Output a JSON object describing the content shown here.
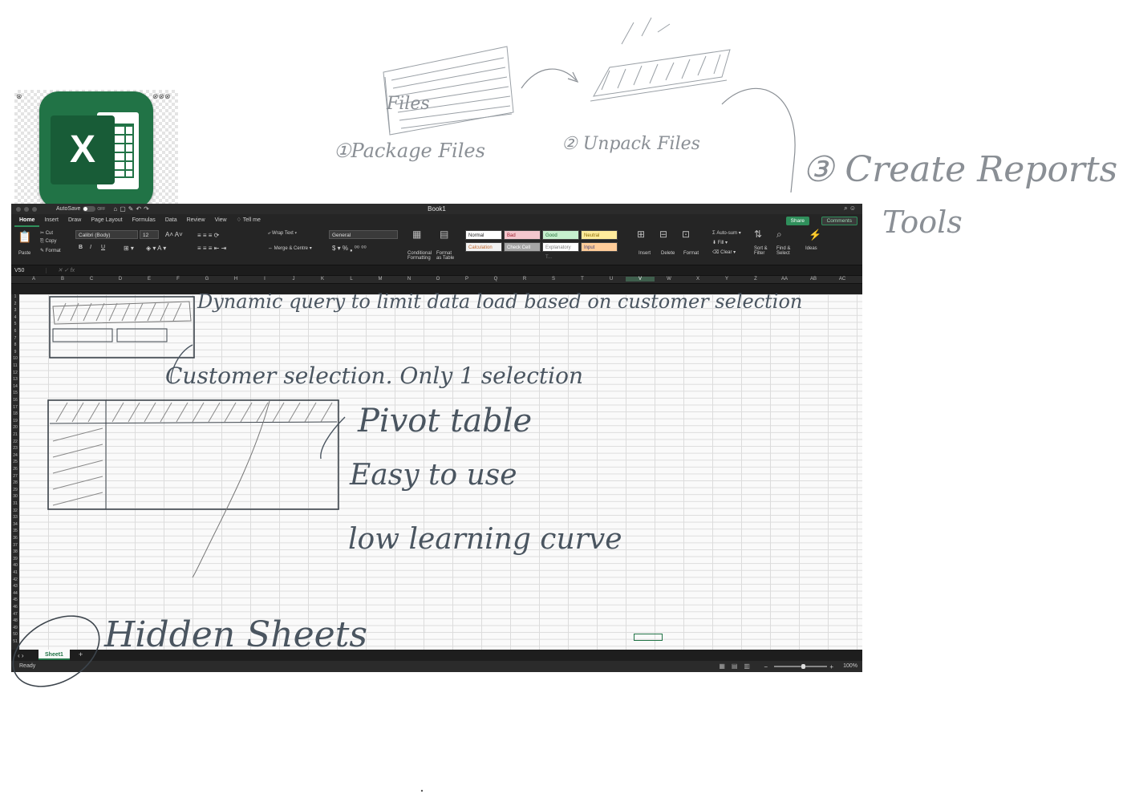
{
  "app_icon": {
    "letter": "X"
  },
  "window": {
    "title": "Book1",
    "autosave_label": "AutoSave",
    "autosave_state": "OFF"
  },
  "tabs": [
    "Home",
    "Insert",
    "Draw",
    "Page Layout",
    "Formulas",
    "Data",
    "Review",
    "View"
  ],
  "tell_me": "Tell me",
  "share_label": "Share",
  "comments_label": "Comments",
  "ribbon": {
    "paste": "Paste",
    "cut": "Cut",
    "copy": "Copy",
    "format": "Format",
    "font_name": "Calibri (Body)",
    "font_size": "12",
    "bold": "B",
    "italic": "I",
    "underline": "U",
    "wrap_text": "Wrap Text",
    "merge_centre": "Merge & Centre",
    "number_format": "General",
    "currency": "$",
    "percent": "%",
    "conditional_formatting": [
      "Conditional",
      "Formatting"
    ],
    "format_as_table": [
      "Format",
      "as Table"
    ],
    "styles": [
      {
        "label": "Normal",
        "bg": "#ffffff",
        "fg": "#222222"
      },
      {
        "label": "Bad",
        "bg": "#f4c7ce",
        "fg": "#9c1c2a"
      },
      {
        "label": "Good",
        "bg": "#c6efce",
        "fg": "#1e6b34"
      },
      {
        "label": "Neutral",
        "bg": "#ffeb9c",
        "fg": "#8a6a00"
      },
      {
        "label": "Calculation",
        "bg": "#f2f2f2",
        "fg": "#c0662b"
      },
      {
        "label": "Check Cell",
        "bg": "#a5a5a5",
        "fg": "#ffffff"
      },
      {
        "label": "Explanatory T...",
        "bg": "#ffffff",
        "fg": "#7f7f7f"
      },
      {
        "label": "Input",
        "bg": "#ffcc99",
        "fg": "#3f3f76"
      }
    ],
    "insert": "Insert",
    "delete": "Delete",
    "format_cells": "Format",
    "autosum": "Auto-sum",
    "fill": "Fill",
    "clear": "Clear",
    "sort_filter": [
      "Sort &",
      "Filter"
    ],
    "find_select": [
      "Find &",
      "Select"
    ],
    "ideas": "Ideas"
  },
  "formula_bar": {
    "name_box": "V50",
    "fx": "fx"
  },
  "columns": [
    "A",
    "B",
    "C",
    "D",
    "E",
    "F",
    "G",
    "H",
    "I",
    "J",
    "K",
    "L",
    "M",
    "N",
    "O",
    "P",
    "Q",
    "R",
    "S",
    "T",
    "U",
    "V",
    "W",
    "X",
    "Y",
    "Z",
    "AA",
    "AB",
    "AC"
  ],
  "selected_column": "V",
  "row_count": 51,
  "sheet_tab": "Sheet1",
  "status": "Ready",
  "zoom": "100%",
  "annotations": {
    "files": "Files",
    "step1": "①Package Files",
    "step2": "② Unpack Files",
    "step3": "③ Create Reports",
    "tools": "Tools",
    "dynamic_query": "Dynamic query  to limit data load based on customer selection",
    "customer_selection": "Customer selection. Only 1 selection",
    "pivot_table": "Pivot table",
    "easy_to_use": "Easy to use",
    "low_learning": "low learning curve",
    "hidden_sheets": "Hidden Sheets"
  }
}
